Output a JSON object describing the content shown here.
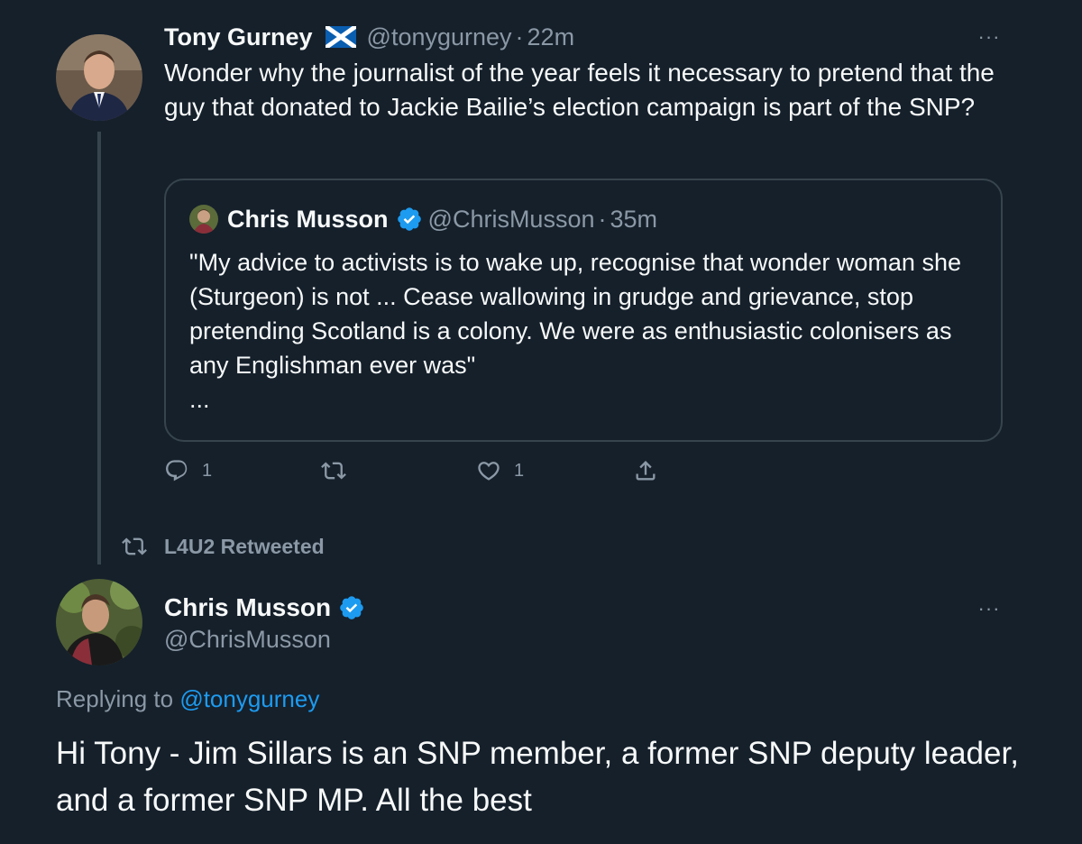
{
  "tweet": {
    "author_name": "Tony Gurney",
    "author_flag_icon": "scotland-flag-icon",
    "author_handle": "@tonygurney",
    "separator": "·",
    "time": "22m",
    "text": "Wonder why the journalist of the year feels it necessary to pretend that the guy that donated to Jackie Bailie’s election campaign is part of the SNP?",
    "more_label": "···",
    "quote": {
      "author_name": "Chris Musson",
      "author_handle": "@ChrisMusson",
      "separator": "·",
      "time": "35m",
      "text": "\"My advice to activists is to wake up, recognise that wonder woman she (Sturgeon) is not ... Cease wallowing in grudge and grievance, stop pretending Scotland is a colony. We were as enthusiastic colonisers as any Englishman ever was\"",
      "ellipsis": "..."
    },
    "actions": {
      "reply_count": "1",
      "retweet_count": "",
      "like_count": "1"
    }
  },
  "retweet_banner": {
    "label": "L4U2 Retweeted"
  },
  "reply_tweet": {
    "author_name": "Chris Musson",
    "author_handle": "@ChrisMusson",
    "more_label": "···",
    "replying_prefix": "Replying to ",
    "replying_to": "@tonygurney",
    "text": "Hi Tony - Jim Sillars is an SNP member, a former SNP deputy leader, and a former SNP MP. All the best"
  },
  "colors": {
    "background": "#15202b",
    "text": "#f7f9f9",
    "muted": "#8b98a5",
    "border": "#38444d",
    "accent": "#1d9bf0"
  }
}
